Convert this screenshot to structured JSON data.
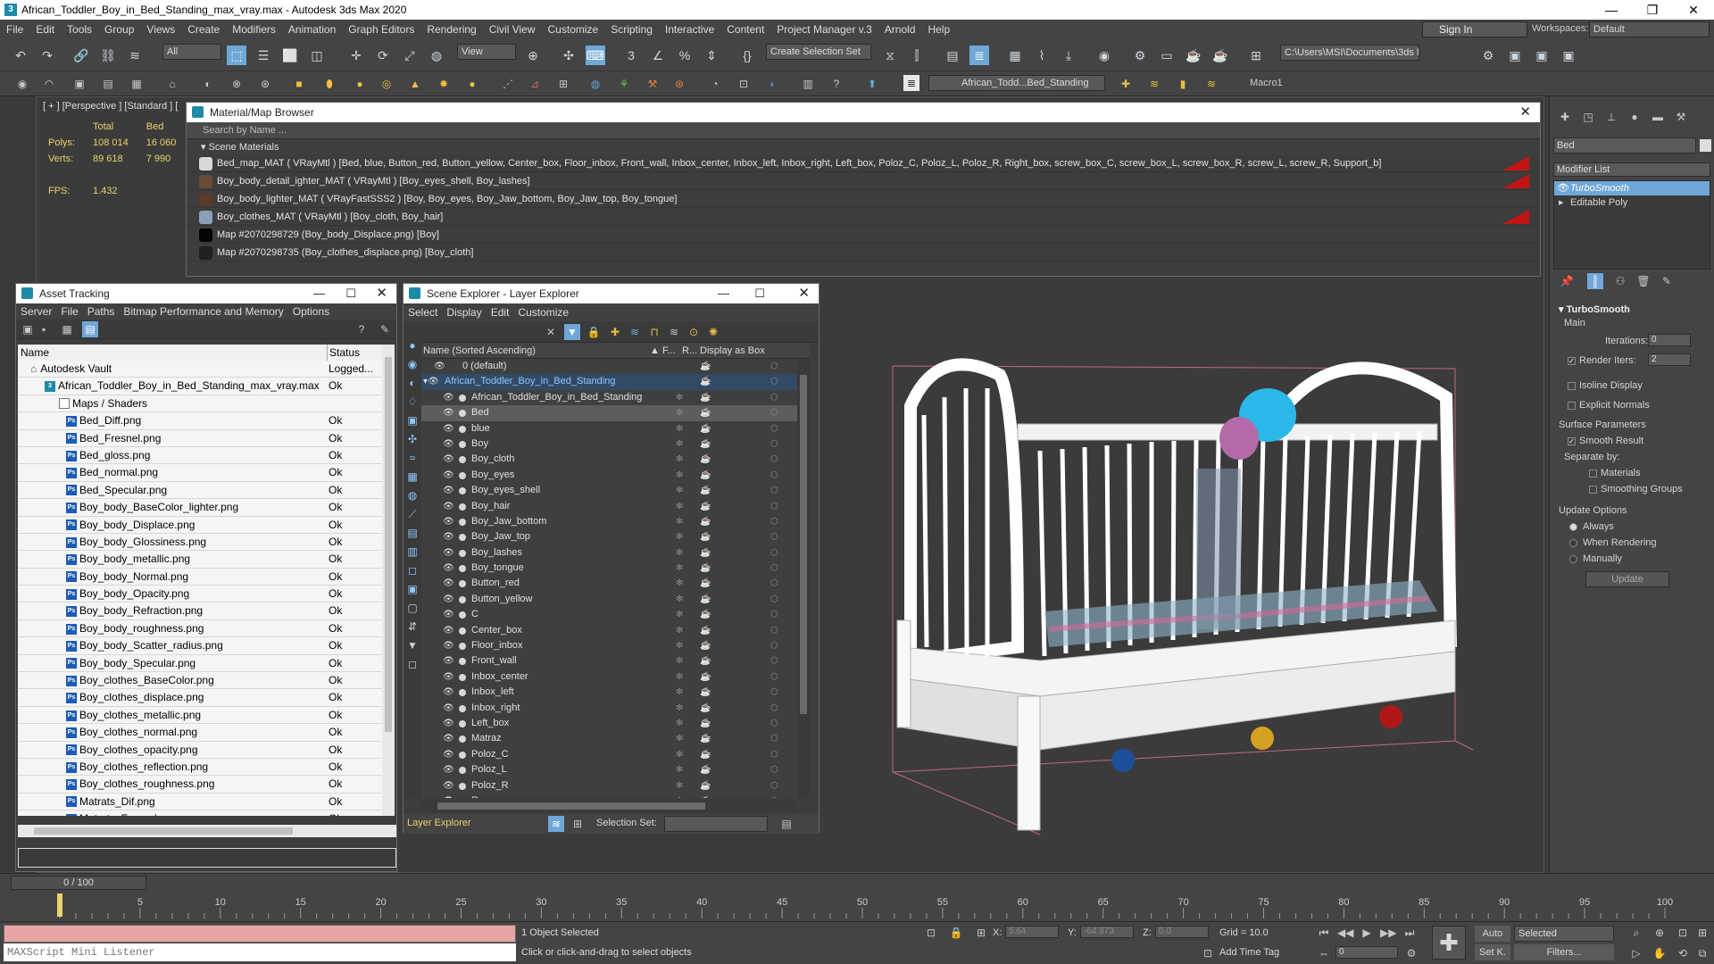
{
  "window": {
    "title": "African_Toddler_Boy_in_Bed_Standing_max_vray.max - Autodesk 3ds Max 2020"
  },
  "menu": [
    "File",
    "Edit",
    "Tools",
    "Group",
    "Views",
    "Create",
    "Modifiers",
    "Animation",
    "Graph Editors",
    "Rendering",
    "Civil View",
    "Customize",
    "Scripting",
    "Interactive",
    "Content",
    "Project Manager v.3",
    "Arnold",
    "Help"
  ],
  "signin": "Sign In",
  "workspaces": {
    "label": "Workspaces:",
    "value": "Default"
  },
  "toolbar": {
    "filter": "All",
    "view": "View",
    "selection_set": "Create Selection Set",
    "path": "C:\\Users\\MSI\\Documents\\3ds Max 2020",
    "layer": "African_Todd...Bed_Standing",
    "macro": "Macro1"
  },
  "viewport": {
    "label": "[ + ] [Perspective ] [Standard ] [",
    "stats": {
      "h_total": "Total",
      "h_sel": "Bed",
      "polys_label": "Polys:",
      "polys_total": "108 014",
      "polys_sel": "16 060",
      "verts_label": "Verts:",
      "verts_total": "89 618",
      "verts_sel": "7 990",
      "fps_label": "FPS:",
      "fps": "1.432"
    }
  },
  "material_browser": {
    "title": "Material/Map Browser",
    "search": "Search by Name ...",
    "section": "Scene Materials",
    "rows": [
      {
        "text": "Bed_map_MAT  ( VRayMtl )  [Bed, blue, Button_red, Button_yellow, Center_box, Floor_inbox, Front_wall, Inbox_center, Inbox_left, Inbox_right, Left_box, Poloz_C, Poloz_L, Poloz_R, Right_box, screw_box_C, screw_box_L, screw_box_R, screw_L, screw_R, Support_b]",
        "swatch": "#d8d8d8",
        "flag": true
      },
      {
        "text": "Boy_body_detail_ighter_MAT  ( VRayMtl )  [Boy_eyes_shell, Boy_lashes]",
        "swatch": "#6b4a38",
        "flag": true
      },
      {
        "text": "Boy_body_lighter_MAT  ( VRayFastSSS2 )  [Boy, Boy_eyes, Boy_Jaw_bottom, Boy_Jaw_top, Boy_tongue]",
        "swatch": "#5a3a2a",
        "flag": false
      },
      {
        "text": "Boy_clothes_MAT  ( VRayMtl )  [Boy_cloth, Boy_hair]",
        "swatch": "#8aa0b8",
        "flag": true
      },
      {
        "text": "Map #2070298729 (Boy_body_Displace.png)  [Boy]",
        "swatch": "#050505",
        "flag": false
      },
      {
        "text": "Map #2070298735 (Boy_clothes_displace.png)  [Boy_cloth]",
        "swatch": "#202020",
        "flag": false
      }
    ]
  },
  "asset_tracking": {
    "title": "Asset Tracking",
    "menu": [
      "Server",
      "File",
      "Paths",
      "Bitmap Performance and Memory",
      "Options"
    ],
    "col_name": "Name",
    "col_status": "Status",
    "vault": {
      "name": "Autodesk Vault",
      "status": "Logged..."
    },
    "file": {
      "name": "African_Toddler_Boy_in_Bed_Standing_max_vray.max",
      "status": "Ok"
    },
    "maps_group": "Maps / Shaders",
    "maps": [
      "Bed_Diff.png",
      "Bed_Fresnel.png",
      "Bed_gloss.png",
      "Bed_normal.png",
      "Bed_Specular.png",
      "Boy_body_BaseColor_lighter.png",
      "Boy_body_Displace.png",
      "Boy_body_Glossiness.png",
      "Boy_body_metallic.png",
      "Boy_body_Normal.png",
      "Boy_body_Opacity.png",
      "Boy_body_Refraction.png",
      "Boy_body_roughness.png",
      "Boy_body_Scatter_radius.png",
      "Boy_body_Specular.png",
      "Boy_clothes_BaseColor.png",
      "Boy_clothes_displace.png",
      "Boy_clothes_metallic.png",
      "Boy_clothes_normal.png",
      "Boy_clothes_opacity.png",
      "Boy_clothes_reflection.png",
      "Boy_clothes_roughness.png",
      "Matrats_Dif.png",
      "Matrats_Fresnel.png"
    ],
    "ok": "Ok"
  },
  "scene_explorer": {
    "title": "Scene Explorer - Layer Explorer",
    "menu": [
      "Select",
      "Display",
      "Edit",
      "Customize"
    ],
    "col_name": "Name (Sorted Ascending)",
    "col_f": "▲ F...",
    "col_r": "R...",
    "col_box": "Display as Box",
    "default_layer": "0 (default)",
    "layer": "African_Toddler_Boy_in_Bed_Standing",
    "objects": [
      "African_Toddler_Boy_in_Bed_Standing",
      "Bed",
      "blue",
      "Boy",
      "Boy_cloth",
      "Boy_eyes",
      "Boy_eyes_shell",
      "Boy_hair",
      "Boy_Jaw_bottom",
      "Boy_Jaw_top",
      "Boy_lashes",
      "Boy_tongue",
      "Button_red",
      "Button_yellow",
      "C",
      "Center_box",
      "Floor_inbox",
      "Front_wall",
      "Inbox_center",
      "Inbox_left",
      "Inbox_right",
      "Left_box",
      "Matraz",
      "Poloz_C",
      "Poloz_L",
      "Poloz_R",
      "R"
    ],
    "selected": "Bed",
    "footer_layer": "Layer Explorer",
    "footer_selset": "Selection Set:"
  },
  "command_panel": {
    "name": "Bed",
    "modifier_list": "Modifier List",
    "stack": [
      "TurboSmooth",
      "Editable Poly"
    ],
    "turbosmooth": {
      "title": "TurboSmooth",
      "main": "Main",
      "iterations_label": "Iterations:",
      "iterations": "0",
      "render_iters_label": "Render Iters:",
      "render_iters": "2",
      "isoline": "Isoline Display",
      "explicit": "Explicit Normals",
      "surface": "Surface Parameters",
      "smooth_result": "Smooth Result",
      "separate": "Separate by:",
      "materials": "Materials",
      "smoothing": "Smoothing Groups",
      "update_options": "Update Options",
      "always": "Always",
      "when_rendering": "When Rendering",
      "manually": "Manually",
      "update": "Update"
    }
  },
  "timeline": {
    "frame": "0 / 100",
    "ticks": [
      "0",
      "5",
      "10",
      "15",
      "20",
      "25",
      "30",
      "35",
      "40",
      "45",
      "50",
      "55",
      "60",
      "65",
      "70",
      "75",
      "80",
      "85",
      "90",
      "95",
      "100"
    ]
  },
  "status": {
    "listener": "MAXScript Mini Listener",
    "objects": "1 Object Selected",
    "prompt": "Click or click-and-drag to select objects",
    "x_label": "X:",
    "x": "5.64",
    "y_label": "Y:",
    "y": "-64.873",
    "z_label": "Z:",
    "z": "0.0",
    "grid": "Grid = 10.0",
    "add_time_tag": "Add Time Tag",
    "auto": "Auto",
    "setk": "Set K.",
    "selected": "Selected",
    "filters": "Filters...",
    "frame": "0"
  }
}
